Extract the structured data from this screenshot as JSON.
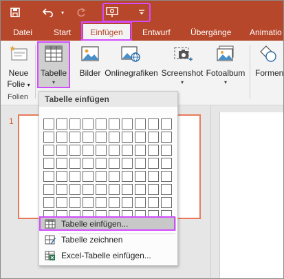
{
  "quick_access": {
    "save_icon": "save-icon",
    "undo_icon": "undo-icon",
    "redo_icon": "redo-icon",
    "present_icon": "start-from-beginning-icon"
  },
  "tabs": [
    {
      "label": "Datei"
    },
    {
      "label": "Start"
    },
    {
      "label": "Einfügen"
    },
    {
      "label": "Entwurf"
    },
    {
      "label": "Übergänge"
    },
    {
      "label": "Animatio"
    }
  ],
  "ribbon": {
    "new_slide": {
      "line1": "Neue",
      "line2": "Folie",
      "caret": "▾"
    },
    "group_slides": "Folien",
    "table": {
      "label": "Tabelle",
      "caret": "▾"
    },
    "pictures": {
      "label": "Bilder"
    },
    "online_pictures": {
      "label": "Onlinegrafiken"
    },
    "screenshot": {
      "label": "Screenshot",
      "caret": "▾"
    },
    "photo_album": {
      "label": "Fotoalbum",
      "caret": "▾"
    },
    "shapes": {
      "label": "Formen"
    }
  },
  "slide_panel": {
    "thumb_number": "1"
  },
  "menu": {
    "header": "Tabelle einfügen",
    "items": [
      {
        "label": "Tabelle einfügen...",
        "icon": "insert-table-icon"
      },
      {
        "label": "Tabelle zeichnen",
        "icon": "draw-table-icon"
      },
      {
        "label": "Excel-Tabelle einfügen...",
        "icon": "excel-table-icon"
      }
    ]
  },
  "colors": {
    "accent": "#b7472a",
    "highlight": "#d24cff"
  }
}
